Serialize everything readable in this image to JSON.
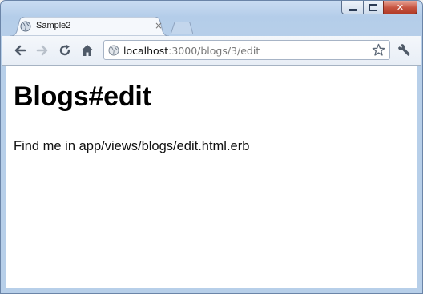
{
  "window": {
    "controls": [
      "minimize",
      "maximize",
      "close"
    ],
    "close_glyph": "✕"
  },
  "tab": {
    "title": "Sample2",
    "favicon": "globe-icon",
    "close_glyph": "×"
  },
  "toolbar": {
    "back_icon": "back-arrow-icon",
    "forward_icon": "forward-arrow-icon",
    "reload_icon": "reload-icon",
    "home_icon": "home-icon",
    "bookmark_icon": "star-icon",
    "settings_icon": "wrench-icon"
  },
  "address_bar": {
    "host": "localhost",
    "rest": ":3000/blogs/3/edit"
  },
  "page": {
    "heading": "Blogs#edit",
    "text": "Find me in app/views/blogs/edit.html.erb"
  },
  "colors": {
    "frame": "#b7cfe9",
    "close_button": "#c65340",
    "page_background": "#ffffff"
  }
}
